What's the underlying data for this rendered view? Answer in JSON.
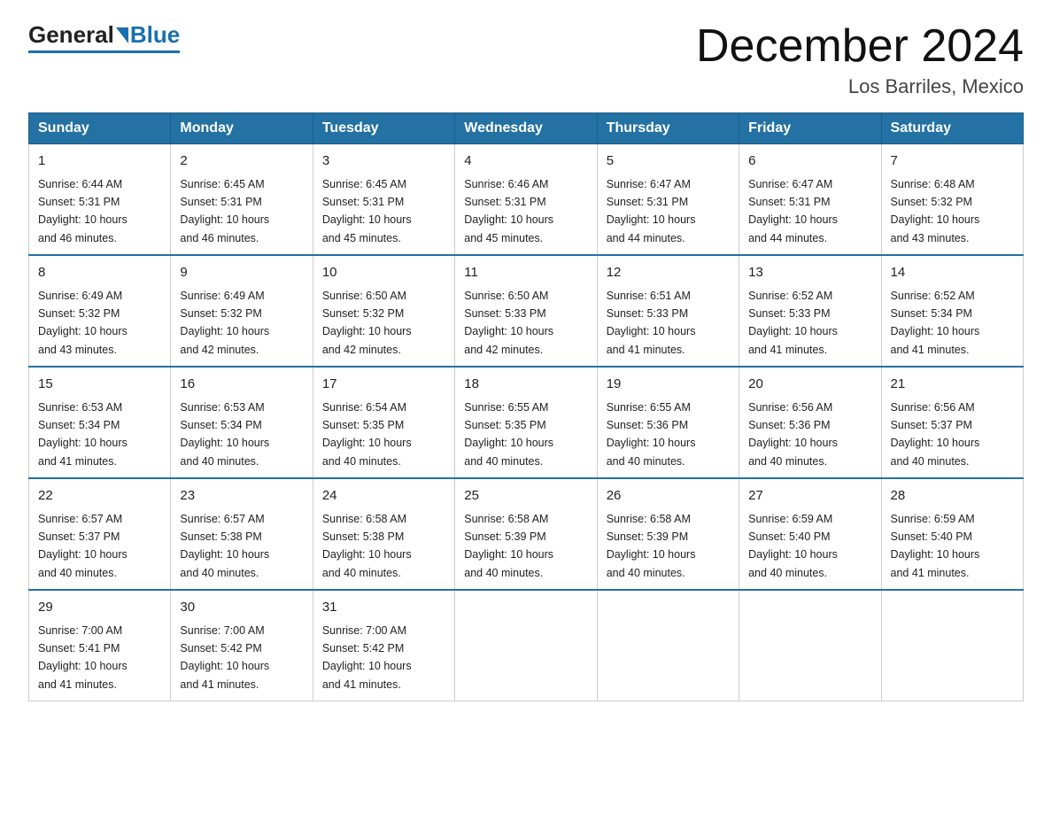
{
  "header": {
    "logo_general": "General",
    "logo_blue": "Blue",
    "month_title": "December 2024",
    "location": "Los Barriles, Mexico"
  },
  "days_of_week": [
    "Sunday",
    "Monday",
    "Tuesday",
    "Wednesday",
    "Thursday",
    "Friday",
    "Saturday"
  ],
  "weeks": [
    [
      {
        "day": "1",
        "sunrise": "6:44 AM",
        "sunset": "5:31 PM",
        "daylight": "10 hours and 46 minutes."
      },
      {
        "day": "2",
        "sunrise": "6:45 AM",
        "sunset": "5:31 PM",
        "daylight": "10 hours and 46 minutes."
      },
      {
        "day": "3",
        "sunrise": "6:45 AM",
        "sunset": "5:31 PM",
        "daylight": "10 hours and 45 minutes."
      },
      {
        "day": "4",
        "sunrise": "6:46 AM",
        "sunset": "5:31 PM",
        "daylight": "10 hours and 45 minutes."
      },
      {
        "day": "5",
        "sunrise": "6:47 AM",
        "sunset": "5:31 PM",
        "daylight": "10 hours and 44 minutes."
      },
      {
        "day": "6",
        "sunrise": "6:47 AM",
        "sunset": "5:31 PM",
        "daylight": "10 hours and 44 minutes."
      },
      {
        "day": "7",
        "sunrise": "6:48 AM",
        "sunset": "5:32 PM",
        "daylight": "10 hours and 43 minutes."
      }
    ],
    [
      {
        "day": "8",
        "sunrise": "6:49 AM",
        "sunset": "5:32 PM",
        "daylight": "10 hours and 43 minutes."
      },
      {
        "day": "9",
        "sunrise": "6:49 AM",
        "sunset": "5:32 PM",
        "daylight": "10 hours and 42 minutes."
      },
      {
        "day": "10",
        "sunrise": "6:50 AM",
        "sunset": "5:32 PM",
        "daylight": "10 hours and 42 minutes."
      },
      {
        "day": "11",
        "sunrise": "6:50 AM",
        "sunset": "5:33 PM",
        "daylight": "10 hours and 42 minutes."
      },
      {
        "day": "12",
        "sunrise": "6:51 AM",
        "sunset": "5:33 PM",
        "daylight": "10 hours and 41 minutes."
      },
      {
        "day": "13",
        "sunrise": "6:52 AM",
        "sunset": "5:33 PM",
        "daylight": "10 hours and 41 minutes."
      },
      {
        "day": "14",
        "sunrise": "6:52 AM",
        "sunset": "5:34 PM",
        "daylight": "10 hours and 41 minutes."
      }
    ],
    [
      {
        "day": "15",
        "sunrise": "6:53 AM",
        "sunset": "5:34 PM",
        "daylight": "10 hours and 41 minutes."
      },
      {
        "day": "16",
        "sunrise": "6:53 AM",
        "sunset": "5:34 PM",
        "daylight": "10 hours and 40 minutes."
      },
      {
        "day": "17",
        "sunrise": "6:54 AM",
        "sunset": "5:35 PM",
        "daylight": "10 hours and 40 minutes."
      },
      {
        "day": "18",
        "sunrise": "6:55 AM",
        "sunset": "5:35 PM",
        "daylight": "10 hours and 40 minutes."
      },
      {
        "day": "19",
        "sunrise": "6:55 AM",
        "sunset": "5:36 PM",
        "daylight": "10 hours and 40 minutes."
      },
      {
        "day": "20",
        "sunrise": "6:56 AM",
        "sunset": "5:36 PM",
        "daylight": "10 hours and 40 minutes."
      },
      {
        "day": "21",
        "sunrise": "6:56 AM",
        "sunset": "5:37 PM",
        "daylight": "10 hours and 40 minutes."
      }
    ],
    [
      {
        "day": "22",
        "sunrise": "6:57 AM",
        "sunset": "5:37 PM",
        "daylight": "10 hours and 40 minutes."
      },
      {
        "day": "23",
        "sunrise": "6:57 AM",
        "sunset": "5:38 PM",
        "daylight": "10 hours and 40 minutes."
      },
      {
        "day": "24",
        "sunrise": "6:58 AM",
        "sunset": "5:38 PM",
        "daylight": "10 hours and 40 minutes."
      },
      {
        "day": "25",
        "sunrise": "6:58 AM",
        "sunset": "5:39 PM",
        "daylight": "10 hours and 40 minutes."
      },
      {
        "day": "26",
        "sunrise": "6:58 AM",
        "sunset": "5:39 PM",
        "daylight": "10 hours and 40 minutes."
      },
      {
        "day": "27",
        "sunrise": "6:59 AM",
        "sunset": "5:40 PM",
        "daylight": "10 hours and 40 minutes."
      },
      {
        "day": "28",
        "sunrise": "6:59 AM",
        "sunset": "5:40 PM",
        "daylight": "10 hours and 41 minutes."
      }
    ],
    [
      {
        "day": "29",
        "sunrise": "7:00 AM",
        "sunset": "5:41 PM",
        "daylight": "10 hours and 41 minutes."
      },
      {
        "day": "30",
        "sunrise": "7:00 AM",
        "sunset": "5:42 PM",
        "daylight": "10 hours and 41 minutes."
      },
      {
        "day": "31",
        "sunrise": "7:00 AM",
        "sunset": "5:42 PM",
        "daylight": "10 hours and 41 minutes."
      },
      null,
      null,
      null,
      null
    ]
  ],
  "labels": {
    "sunrise": "Sunrise:",
    "sunset": "Sunset:",
    "daylight": "Daylight:"
  }
}
